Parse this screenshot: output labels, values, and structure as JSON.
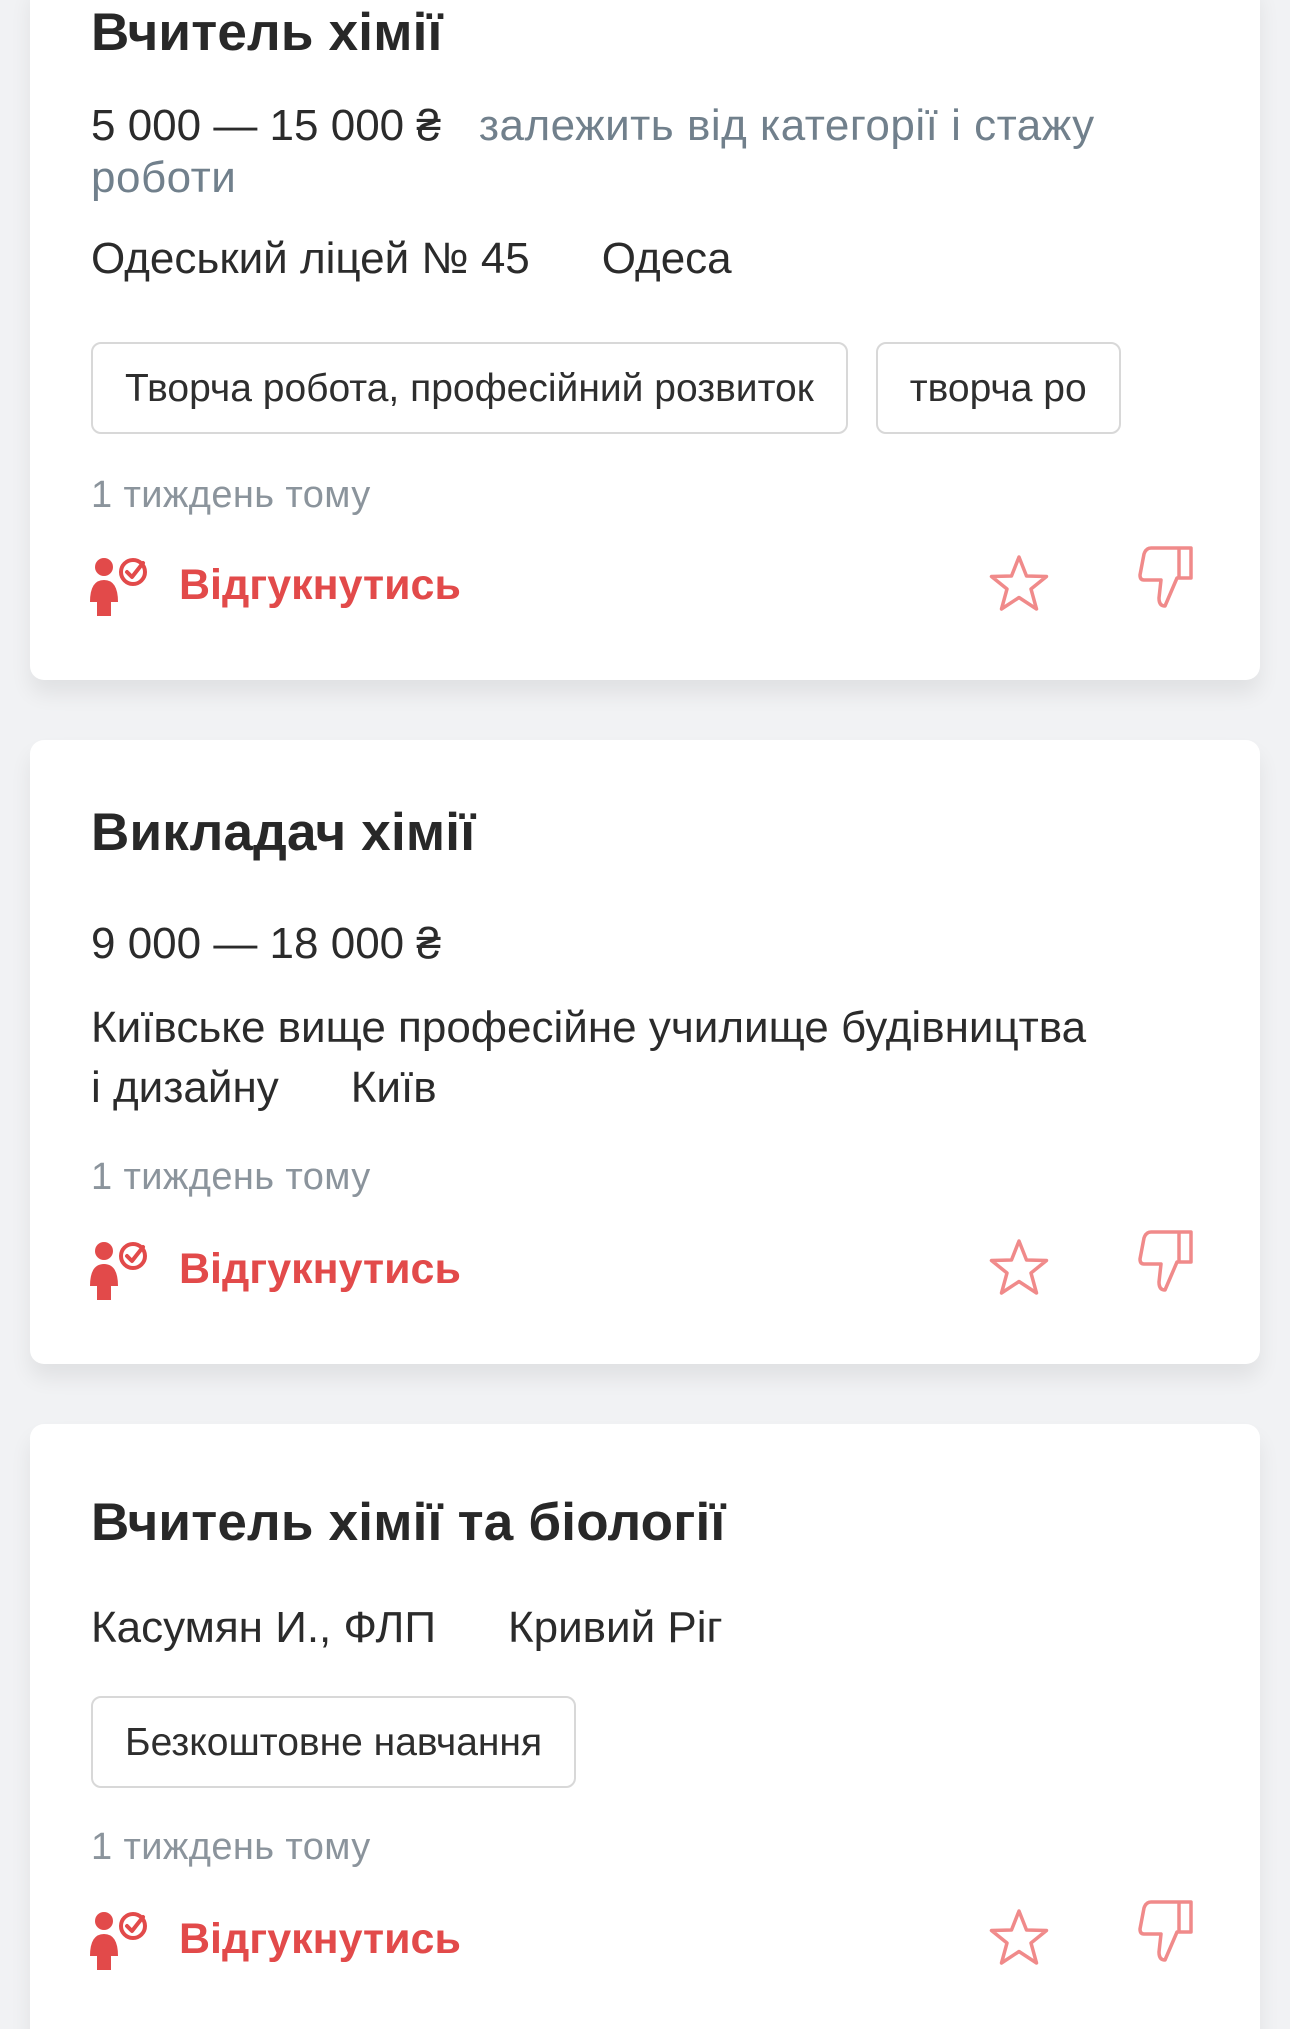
{
  "vacancies": [
    {
      "title": "Вчитель хімії",
      "salary": "5 000 — 15 000 ₴",
      "salary_note": "залежить від категорії і стажу роботи",
      "employer": "Одеський ліцей № 45",
      "city": "Одеса",
      "tags": [
        "Творча робота, професійний розвиток",
        "творча ро"
      ],
      "posted": "1 тиждень тому",
      "apply_label": "Відгукнутись"
    },
    {
      "title": "Викладач хімії",
      "salary": "9 000 — 18 000 ₴",
      "employer": "Київське вище професійне училище будівництва і дизайну",
      "city": "Київ",
      "posted": "1 тиждень тому",
      "apply_label": "Відгукнутись"
    },
    {
      "title": "Вчитель хімії та біології",
      "employer": "Касумян И., ФЛП",
      "city": "Кривий Ріг",
      "tags": [
        "Безкоштовне навчання"
      ],
      "posted": "1 тиждень тому",
      "apply_label": "Відгукнутись"
    }
  ],
  "icons": {
    "apply": "person-check-icon",
    "favorite": "star-outline-icon",
    "dislike": "thumbs-down-icon"
  },
  "colors": {
    "accent": "#e24a4a",
    "accent_light": "#f08a8a",
    "muted_text": "#8b949c",
    "salary_note": "#71808c",
    "tag_border": "#d8d8d8",
    "background": "#f1f2f4",
    "card": "#ffffff"
  }
}
